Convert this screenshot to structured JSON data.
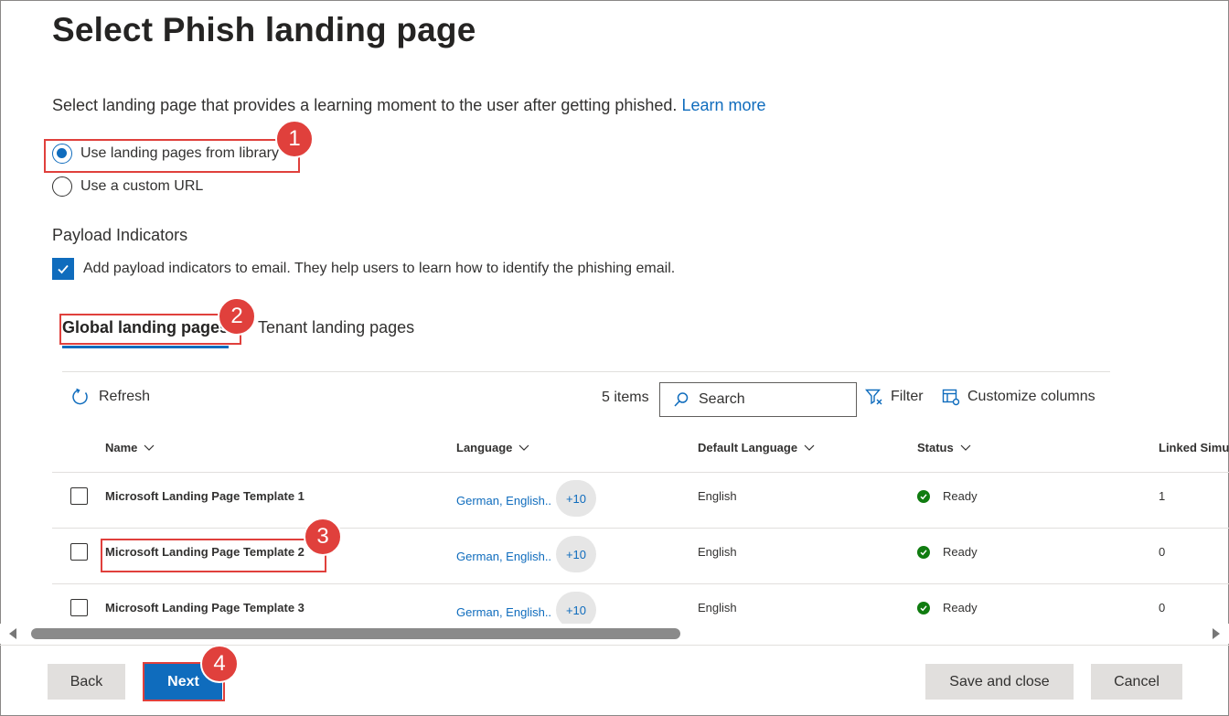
{
  "page": {
    "title": "Select Phish landing page",
    "description": "Select landing page that provides a learning moment to the user after getting phished.",
    "learn_more": "Learn more"
  },
  "landing_source": {
    "options": [
      {
        "label": "Use landing pages from library",
        "selected": true
      },
      {
        "label": "Use a custom URL",
        "selected": false
      }
    ]
  },
  "payload": {
    "heading": "Payload Indicators",
    "checkbox_label": "Add payload indicators to email. They help users to learn how to identify the phishing email.",
    "checked": true
  },
  "tabs": [
    {
      "label": "Global landing pages",
      "active": true
    },
    {
      "label": "Tenant landing pages",
      "active": false
    }
  ],
  "toolbar": {
    "refresh": "Refresh",
    "count": "5 items",
    "search_placeholder": "Search",
    "filter": "Filter",
    "customize": "Customize columns"
  },
  "table": {
    "columns": [
      "Name",
      "Language",
      "Default Language",
      "Status",
      "Linked Simu"
    ],
    "rows": [
      {
        "name": "Microsoft Landing Page Template 1",
        "language": "German, English..",
        "more": "+10",
        "default_language": "English",
        "status": "Ready",
        "linked": "1"
      },
      {
        "name": "Microsoft Landing Page Template 2",
        "language": "German, English..",
        "more": "+10",
        "default_language": "English",
        "status": "Ready",
        "linked": "0"
      },
      {
        "name": "Microsoft Landing Page Template 3",
        "language": "German, English..",
        "more": "+10",
        "default_language": "English",
        "status": "Ready",
        "linked": "0"
      }
    ]
  },
  "footer": {
    "back": "Back",
    "next": "Next",
    "save_close": "Save and close",
    "cancel": "Cancel"
  },
  "callouts": [
    "1",
    "2",
    "3",
    "4"
  ],
  "colors": {
    "accent": "#0f6cbd",
    "callout": "#e0403c",
    "status_ready": "#107c10"
  }
}
